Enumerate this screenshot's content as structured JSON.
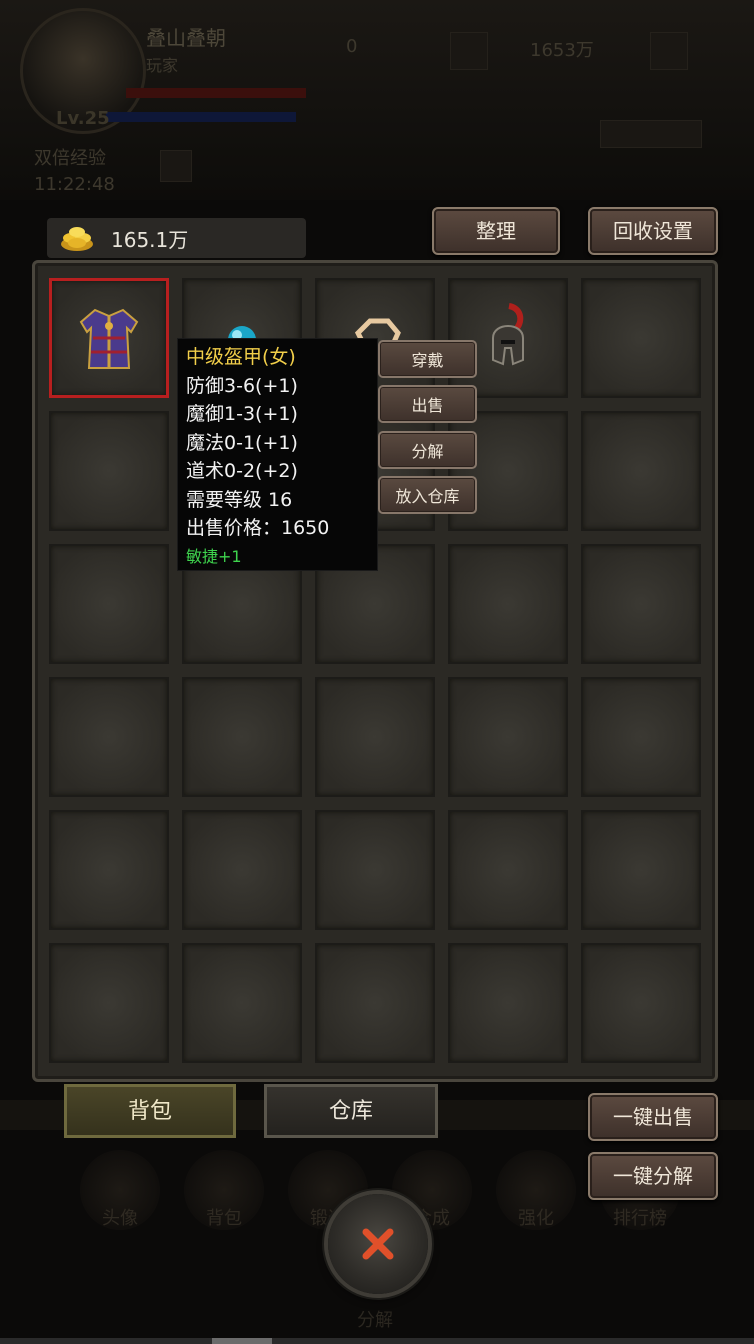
{
  "background": {
    "player_name": "叠山叠朝",
    "player_sub": "玩家",
    "level": "Lv.25",
    "exp_label": "双倍经验",
    "clock": "11:22:48",
    "currency_1": "0",
    "currency_2": "1653万",
    "bottom_label": "分解",
    "nav": [
      "头像",
      "背包",
      "锻造",
      "合成",
      "强化",
      "排行榜"
    ]
  },
  "gold": {
    "value": "165.1万",
    "icon": "gold-coins-icon"
  },
  "buttons": {
    "tidy": "整理",
    "recycle_settings": "回收设置",
    "sell_all": "一键出售",
    "decompose_all": "一键分解"
  },
  "tabs": {
    "bag": "背包",
    "store": "仓库"
  },
  "inventory": {
    "rows": 6,
    "cols": 5,
    "items": [
      {
        "slot": 0,
        "icon": "armor-robe-icon",
        "selected": true
      },
      {
        "slot": 1,
        "icon": "blue-orb-icon"
      },
      {
        "slot": 2,
        "icon": "bracelet-icon"
      },
      {
        "slot": 3,
        "icon": "helmet-icon"
      }
    ]
  },
  "tooltip": {
    "name": "中级盔甲(女)",
    "lines": [
      "防御3-6(+1)",
      "魔御1-3(+1)",
      "魔法0-1(+1)",
      "道术0-2(+2)",
      "需要等级 16",
      "出售价格：1650"
    ],
    "bonus": "敏捷+1"
  },
  "item_menu": {
    "wear": "穿戴",
    "sell": "出售",
    "decompose": "分解",
    "store": "放入仓库"
  },
  "close": {
    "icon": "close-x-icon"
  },
  "colors": {
    "selected_border": "#b81f1f",
    "tooltip_name": "#f2cf4a",
    "tooltip_bonus": "#3ed34d",
    "close_x": "#e0502a"
  }
}
